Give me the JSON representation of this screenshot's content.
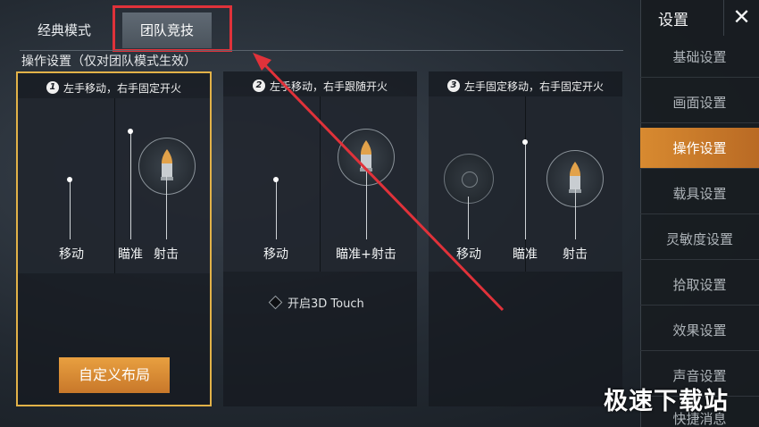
{
  "tabs": {
    "classic": "经典模式",
    "team": "团队竞技"
  },
  "section_title": "操作设置（仅对团队模式生效）",
  "options": [
    {
      "num": "1",
      "title": "左手移动，右手固定开火",
      "labels": {
        "move": "移动",
        "aim": "瞄准",
        "fire": "射击"
      }
    },
    {
      "num": "2",
      "title": "左手移动，右手跟随开火",
      "labels": {
        "move": "移动",
        "aim_fire": "瞄准+射击"
      }
    },
    {
      "num": "3",
      "title": "左手固定移动，右手固定开火",
      "labels": {
        "move": "移动",
        "aim": "瞄准",
        "fire": "射击"
      }
    }
  ],
  "custom_layout_label": "自定义布局",
  "touch_label": "开启3D Touch",
  "sidebar": {
    "title": "设置",
    "close": "✕",
    "items": [
      "基础设置",
      "画面设置",
      "操作设置",
      "载具设置",
      "灵敏度设置",
      "拾取设置",
      "效果设置",
      "声音设置",
      "快捷消息"
    ]
  },
  "watermark": "极速下载站",
  "colors": {
    "accent": "#d88a30",
    "selected_border": "#e2b248",
    "annotation": "#e0323a"
  },
  "icons": [
    "bullet-icon",
    "close-icon",
    "diamond-icon",
    "arrow-annotation"
  ]
}
